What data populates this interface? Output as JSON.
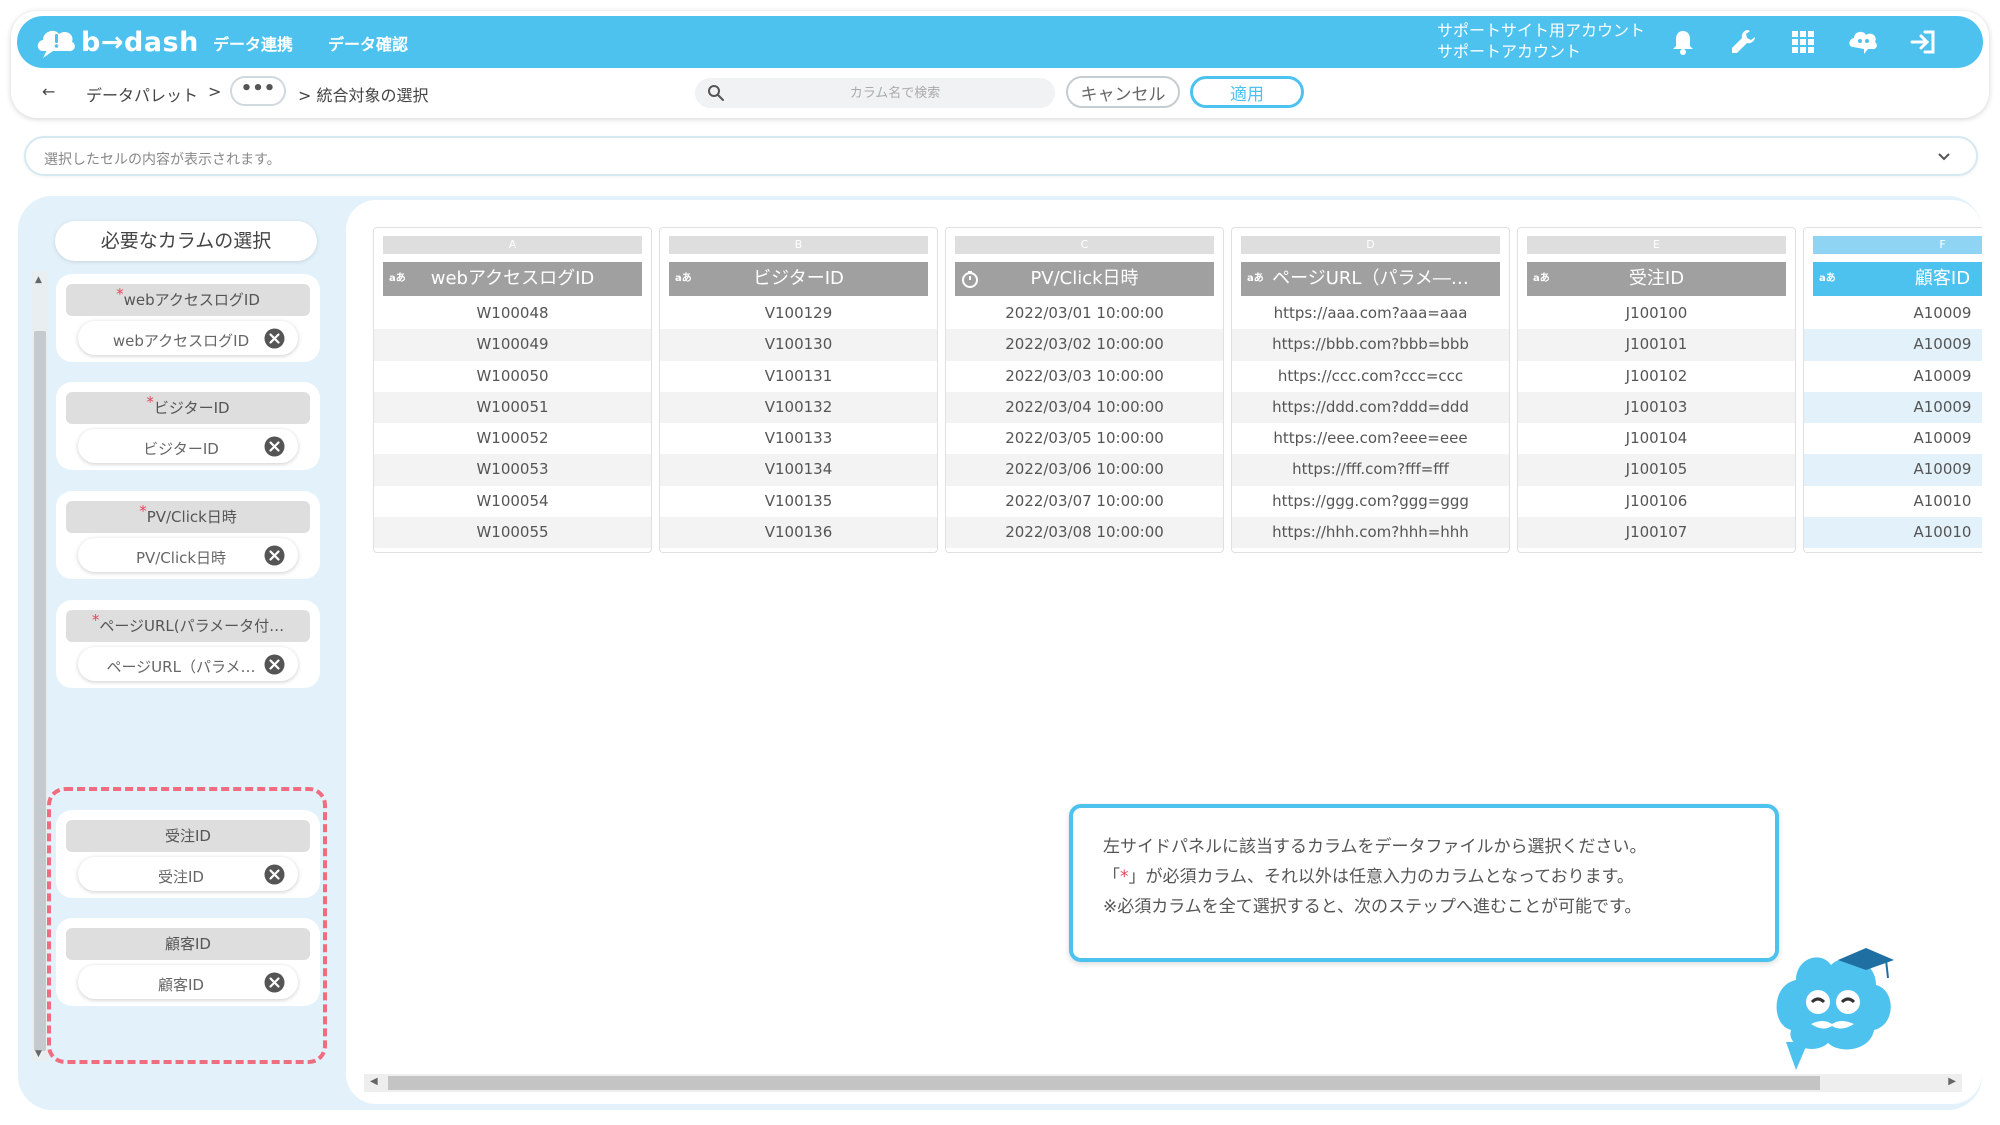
{
  "header": {
    "logo_text": "b→dash",
    "nav": [
      "データ連携",
      "データ確認"
    ],
    "account_line1": "サポートサイト用アカウント",
    "account_line2": "サポートアカウント",
    "icons": [
      "bell-icon",
      "wrench-icon",
      "grid-icon",
      "chat-mascot-icon",
      "logout-icon"
    ],
    "accent_color": "#4dc2ef"
  },
  "breadcrumb": {
    "back": "←",
    "item1": "データパレット",
    "sep": ">",
    "more": "•••",
    "current": "> 統合対象の選択"
  },
  "search": {
    "placeholder": "カラム名で検索",
    "value": ""
  },
  "buttons": {
    "cancel": "キャンセル",
    "apply": "適用"
  },
  "cell_display": {
    "placeholder": "選択したセルの内容が表示されます。"
  },
  "sidebar": {
    "title": "必要なカラムの選択",
    "cards": [
      {
        "label": "webアクセスログID",
        "required": true,
        "chip": "webアクセスログID"
      },
      {
        "label": "ビジターID",
        "required": true,
        "chip": "ビジターID"
      },
      {
        "label": "PV/Click日時",
        "required": true,
        "chip": "PV/Click日時"
      },
      {
        "label": "ページURL(パラメータ付…",
        "required": true,
        "chip": "ページURL（パラメ…"
      },
      {
        "label": "受注ID",
        "required": false,
        "chip": "受注ID"
      },
      {
        "label": "顧客ID",
        "required": false,
        "chip": "顧客ID"
      }
    ],
    "required_mark": "*"
  },
  "table": {
    "columns": [
      {
        "letter": "A",
        "type": "aあ",
        "name": "webアクセスログID",
        "values": [
          "W100048",
          "W100049",
          "W100050",
          "W100051",
          "W100052",
          "W100053",
          "W100054",
          "W100055"
        ]
      },
      {
        "letter": "B",
        "type": "aあ",
        "name": "ビジターID",
        "values": [
          "V100129",
          "V100130",
          "V100131",
          "V100132",
          "V100133",
          "V100134",
          "V100135",
          "V100136"
        ]
      },
      {
        "letter": "C",
        "type": "clock",
        "name": "PV/Click日時",
        "values": [
          "2022/03/01 10:00:00",
          "2022/03/02 10:00:00",
          "2022/03/03 10:00:00",
          "2022/03/04 10:00:00",
          "2022/03/05 10:00:00",
          "2022/03/06 10:00:00",
          "2022/03/07 10:00:00",
          "2022/03/08 10:00:00"
        ]
      },
      {
        "letter": "D",
        "type": "aあ",
        "name": "ページURL（パラメ―…",
        "values": [
          "https://aaa.com?aaa=aaa",
          "https://bbb.com?bbb=bbb",
          "https://ccc.com?ccc=ccc",
          "https://ddd.com?ddd=ddd",
          "https://eee.com?eee=eee",
          "https://fff.com?fff=fff",
          "https://ggg.com?ggg=ggg",
          "https://hhh.com?hhh=hhh"
        ]
      },
      {
        "letter": "E",
        "type": "aあ",
        "name": "受注ID",
        "values": [
          "J100100",
          "J100101",
          "J100102",
          "J100103",
          "J100104",
          "J100105",
          "J100106",
          "J100107"
        ]
      },
      {
        "letter": "F",
        "type": "aあ",
        "name": "顧客ID",
        "values": [
          "A10009",
          "A10009",
          "A10009",
          "A10009",
          "A10009",
          "A10009",
          "A10010",
          "A10010"
        ],
        "selected": true
      }
    ]
  },
  "help": {
    "line1": "左サイドパネルに該当するカラムをデータファイルから選択ください。",
    "line2_pre": "「",
    "line2_star": "*",
    "line2_post": "」が必須カラム、それ以外は任意入力のカラムとなっております。",
    "line3": "※必須カラムを全て選択すると、次のステップへ進むことが可能です。"
  }
}
